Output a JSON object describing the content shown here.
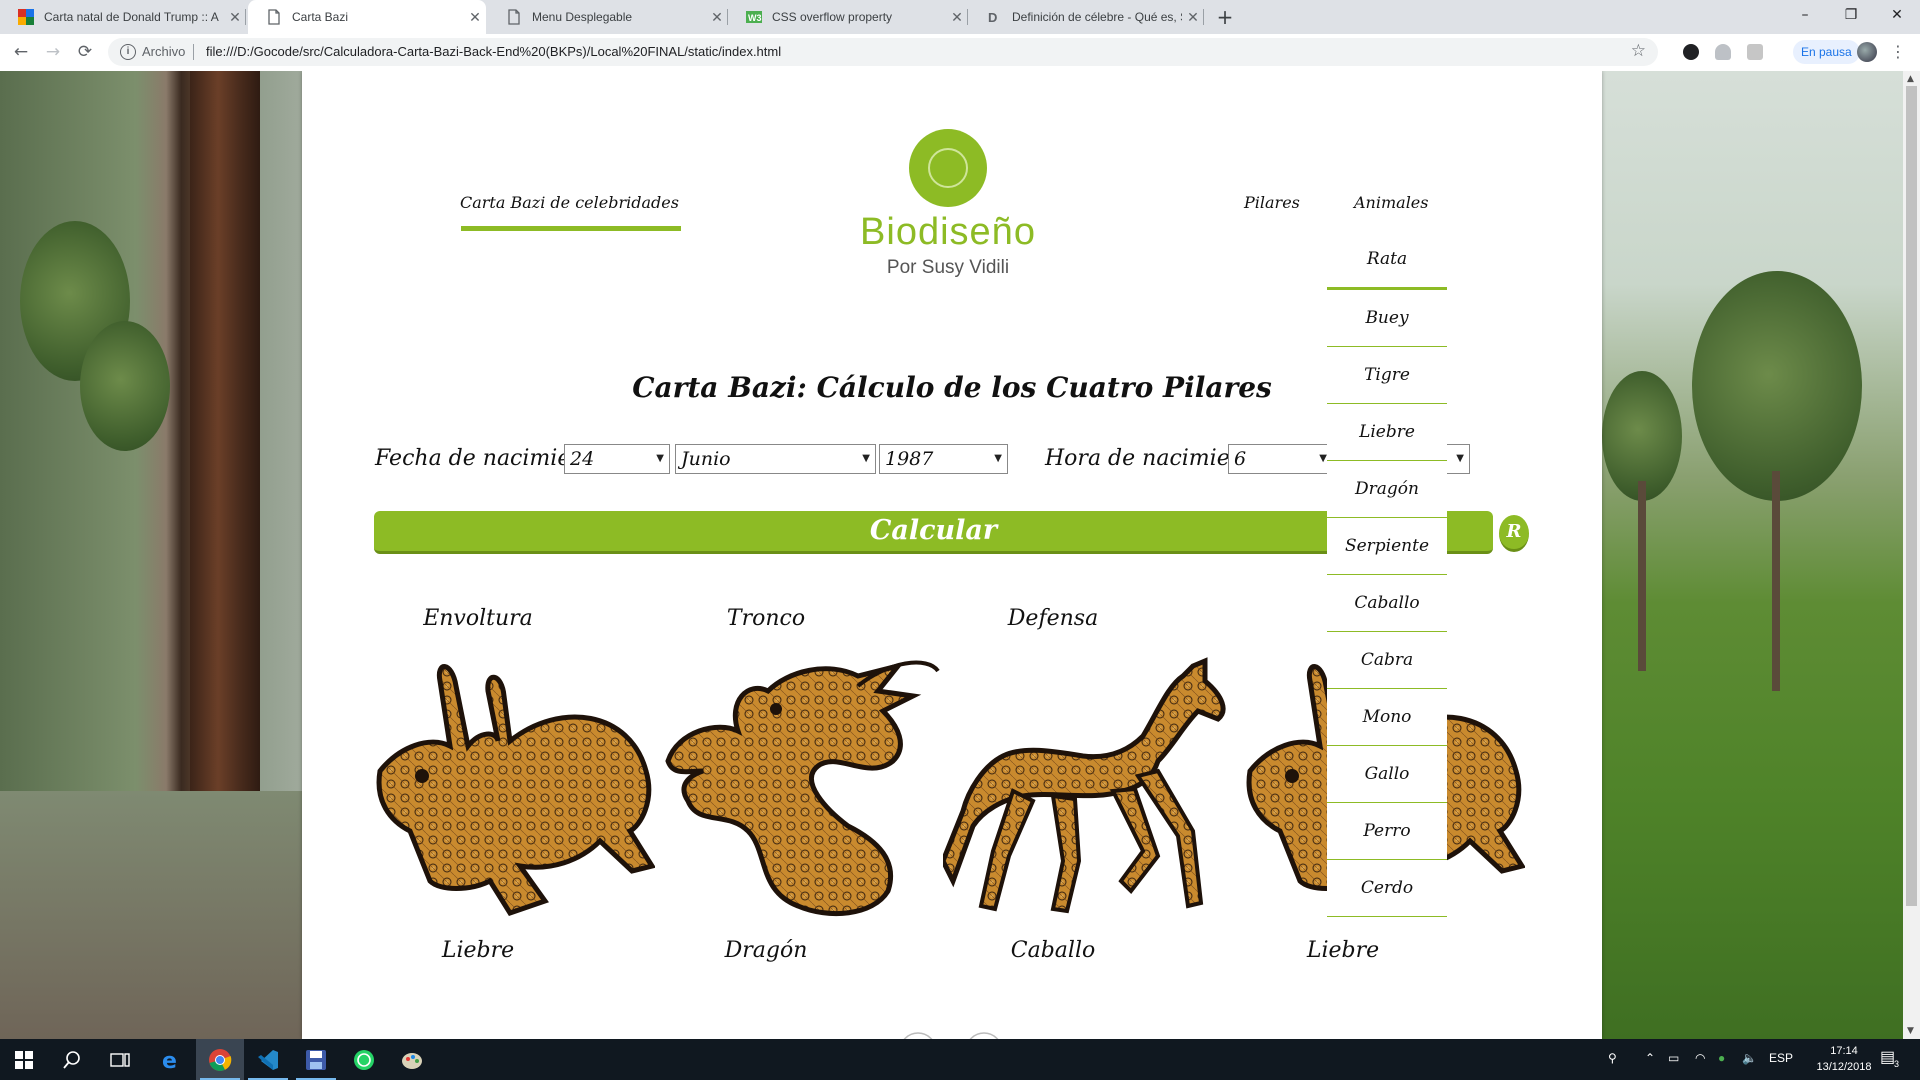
{
  "browser": {
    "tabs": [
      {
        "title": "Carta natal de Donald Trump :: A",
        "icon": "colorful-grid-icon",
        "active": false
      },
      {
        "title": "Carta Bazi",
        "icon": "page-icon",
        "active": true
      },
      {
        "title": "Menu Desplegable",
        "icon": "page-icon",
        "active": false
      },
      {
        "title": "CSS overflow property",
        "icon": "w3schools-icon",
        "active": false
      },
      {
        "title": "Definición de célebre - Qué es, S",
        "icon": "letter-d-icon",
        "active": false
      }
    ],
    "new_tab": "+",
    "window_controls": {
      "minimize": "–",
      "maximize": "❐",
      "close": "✕"
    },
    "nav": {
      "back": "←",
      "forward": "→",
      "reload": "⟳"
    },
    "address": {
      "scheme_label": "Archivo",
      "url": "file:///D:/Gocode/src/Calculadora-Carta-Bazi-Back-End%20(BKPs)/Local%20FINAL/static/index.html",
      "star": "☆"
    },
    "profile_status": "En pausa",
    "menu": "⋮"
  },
  "page": {
    "nav": {
      "celebrities": "Carta Bazi de celebridades",
      "pillars": "Pilares",
      "animals": "Animales"
    },
    "logo": {
      "name": "Biodiseño",
      "tagline": "Por Susy Vidili"
    },
    "title": "Carta Bazi:  Cálculo de los Cuatro Pilares",
    "form": {
      "birth_date_label": "Fecha de nacimiento:",
      "day": "24",
      "month": "Junio",
      "year": "1987",
      "birth_time_label": "Hora de nacimiento:",
      "hour": "6",
      "minute": ""
    },
    "calculate_button": "Calcular",
    "reset_button": "R",
    "pillars": [
      {
        "heading": "Envoltura",
        "animal": "Liebre",
        "art": "rabbit-illustration"
      },
      {
        "heading": "Tronco",
        "animal": "Dragón",
        "art": "dragon-illustration"
      },
      {
        "heading": "Defensa",
        "animal": "Caballo",
        "art": "horse-illustration"
      },
      {
        "heading": "",
        "animal": "Liebre",
        "art": "rabbit-illustration"
      }
    ],
    "animals_menu": [
      "Rata",
      "Buey",
      "Tigre",
      "Liebre",
      "Dragón",
      "Serpiente",
      "Caballo",
      "Cabra",
      "Mono",
      "Gallo",
      "Perro",
      "Cerdo"
    ],
    "colors": {
      "accent": "#8dbb25",
      "accent_dark": "#6a8f16",
      "art_gold": "#c98a2e",
      "art_dark": "#3a2410"
    }
  },
  "taskbar": {
    "apps": [
      "start-icon",
      "search-icon",
      "task-view-icon",
      "edge-icon",
      "chrome-icon",
      "vscode-icon",
      "save-disk-icon",
      "whatsapp-icon",
      "paint-icon"
    ],
    "language": "ESP",
    "time": "17:14",
    "date": "13/12/2018",
    "notifications": "3"
  }
}
